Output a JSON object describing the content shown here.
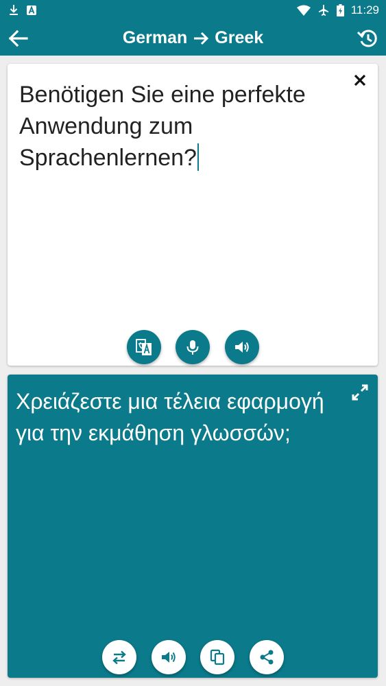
{
  "status_bar": {
    "time": "11:29",
    "left_icons": [
      "download-icon",
      "app-notification-icon"
    ],
    "right_icons": [
      "wifi-icon",
      "airplane-icon",
      "battery-icon"
    ]
  },
  "app_bar": {
    "source_language": "German",
    "target_language": "Greek",
    "icons": [
      "back-arrow-icon",
      "arrow-right-icon",
      "history-icon"
    ]
  },
  "source_card": {
    "text": "Benötigen Sie eine perfekte Anwendung zum Sprachenlernen?",
    "icons": [
      "close-icon",
      "translate-icon",
      "microphone-icon",
      "speaker-icon"
    ]
  },
  "target_card": {
    "text": "Χρειάζεστε μια τέλεια εφαρμογή για την εκμάθηση γλωσσών;",
    "icons": [
      "expand-icon",
      "swap-icon",
      "speaker-icon",
      "copy-icon",
      "share-icon"
    ]
  },
  "colors": {
    "primary": "#0b7a8a",
    "background": "#eeeeee",
    "card": "#ffffff"
  }
}
